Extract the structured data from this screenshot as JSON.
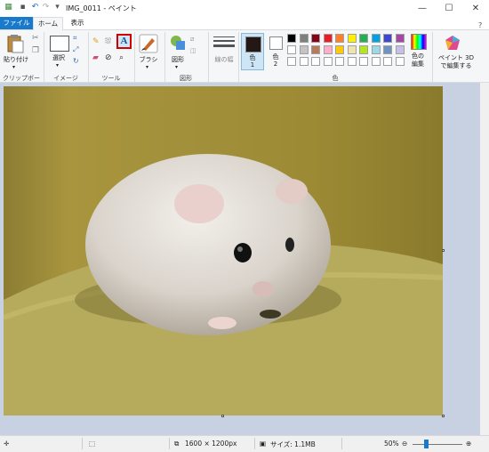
{
  "window": {
    "title": "IMG_0011 - ペイント",
    "minimize": "—",
    "maximize": "☐",
    "close": "✕"
  },
  "tabs": {
    "file": "ファイル",
    "home": "ホーム",
    "view": "表示"
  },
  "ribbon": {
    "clipboard": {
      "paste": "貼り付け",
      "group": "クリップボード"
    },
    "image": {
      "select": "選択",
      "group": "イメージ"
    },
    "tools": {
      "group": "ツール",
      "text_glyph": "A"
    },
    "brush": {
      "label": "ブラシ"
    },
    "shapes": {
      "label": "図形",
      "group": "図形"
    },
    "stroke": {
      "label": "線の幅"
    },
    "colors": {
      "color1": "色\n1",
      "color1_a": "色",
      "color1_b": "1",
      "color2_a": "色",
      "color2_b": "2",
      "edit": "色の",
      "edit2": "編集",
      "group": "色"
    },
    "paint3d": {
      "line1": "ペイント 3D",
      "line2": "で編集する"
    },
    "palette_row1": [
      "#000000",
      "#7f7f7f",
      "#880015",
      "#ed1c24",
      "#ff7f27",
      "#fff200",
      "#22b14c",
      "#00a2e8",
      "#3f48cc",
      "#a349a4"
    ],
    "palette_row2": [
      "#ffffff",
      "#c3c3c3",
      "#b97a57",
      "#ffaec9",
      "#ffc90e",
      "#efe4b0",
      "#b5e61d",
      "#99d9ea",
      "#7092be",
      "#c8bfe7"
    ],
    "palette_row3": [
      "#ffffff",
      "#ffffff",
      "#ffffff",
      "#ffffff",
      "#ffffff",
      "#ffffff",
      "#ffffff",
      "#ffffff",
      "#ffffff",
      "#ffffff"
    ],
    "primary_color": "#231815",
    "secondary_color": "#ffffff"
  },
  "status": {
    "dimensions": "1600 × 1200px",
    "size": "サイズ: 1.1MB",
    "zoom": "50%",
    "zoom_fraction": 0.5
  }
}
